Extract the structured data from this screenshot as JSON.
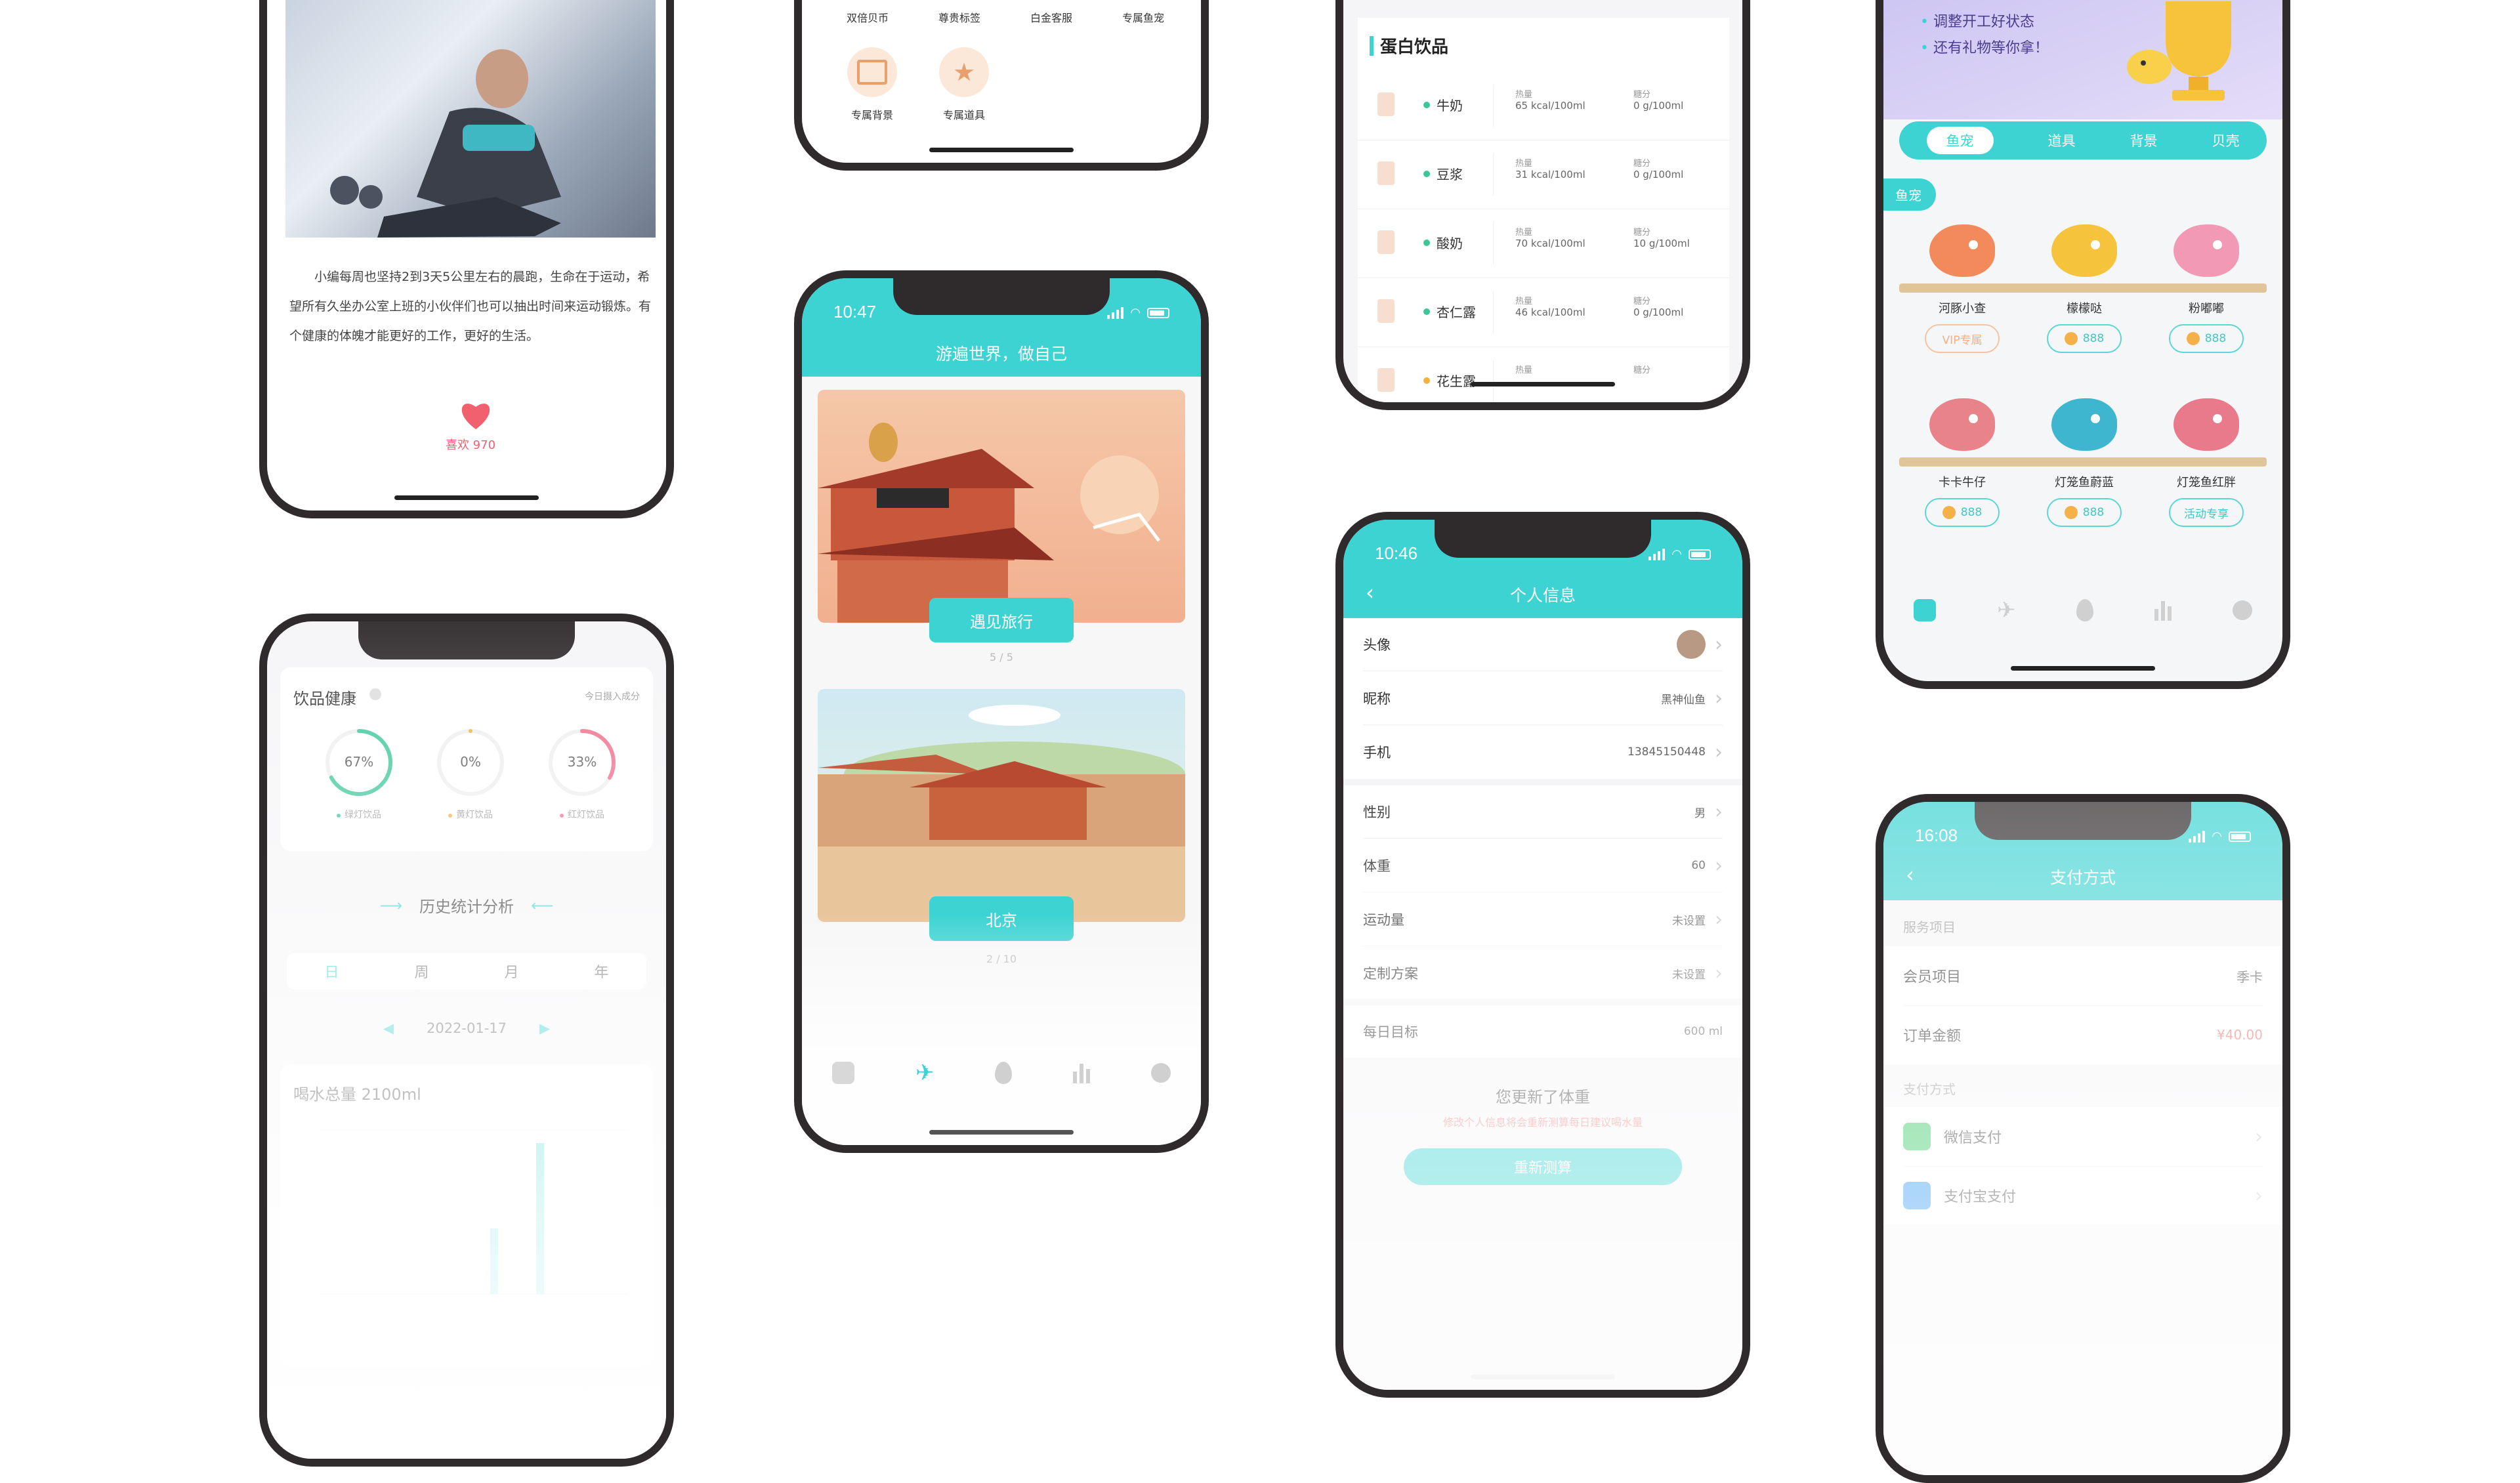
{
  "colors": {
    "accent": "#3dd3d2",
    "frame": "#2f2a2b",
    "heart": "#f0606f",
    "red_price": "#f06b6b"
  },
  "article_phone": {
    "body": "小编每周也坚持2到3天5公里左右的晨跑，生命在于运动，希望所有久坐办公室上班的小伙伴们也可以抽出时间来运动锻炼。有个健康的体魄才能更好的工作，更好的生活。",
    "like_label": "喜欢 970"
  },
  "vip_phone": {
    "benefits_top": [
      "双倍贝币",
      "尊贵标签",
      "白金客服",
      "专属鱼宠"
    ],
    "benefits_bottom": [
      "专属背景",
      "专属道具"
    ]
  },
  "protein_phone": {
    "section_title": "蛋白饮品",
    "items": [
      {
        "name": "牛奶",
        "heat_label": "热量",
        "heat": "65 kcal/100ml",
        "sugar_label": "糖分",
        "sugar": "0 g/100ml",
        "dot": "#3cc79a"
      },
      {
        "name": "豆浆",
        "heat_label": "热量",
        "heat": "31 kcal/100ml",
        "sugar_label": "糖分",
        "sugar": "0 g/100ml",
        "dot": "#3cc79a"
      },
      {
        "name": "酸奶",
        "heat_label": "热量",
        "heat": "70 kcal/100ml",
        "sugar_label": "糖分",
        "sugar": "10 g/100ml",
        "dot": "#3cc79a"
      },
      {
        "name": "杏仁露",
        "heat_label": "热量",
        "heat": "46 kcal/100ml",
        "sugar_label": "糖分",
        "sugar": "0 g/100ml",
        "dot": "#3cc79a"
      },
      {
        "name": "花生露",
        "heat_label": "热量",
        "heat": "",
        "sugar_label": "糖分",
        "sugar": "",
        "dot": "#f2b23c"
      }
    ]
  },
  "shop_phone": {
    "banner_lines": [
      "调整开工好状态",
      "还有礼物等你拿！"
    ],
    "tabs": [
      "鱼宠",
      "道具",
      "背景",
      "贝壳"
    ],
    "section_tag": "鱼宠",
    "row1": [
      {
        "name": "河豚小查",
        "price": "VIP专属"
      },
      {
        "name": "檬檬哒",
        "price": "888"
      },
      {
        "name": "粉嘟嘟",
        "price": "888"
      }
    ],
    "row2": [
      {
        "name": "卡卡牛仔",
        "price": "888"
      },
      {
        "name": "灯笼鱼蔚蓝",
        "price": "888"
      },
      {
        "name": "灯笼鱼红胖",
        "price": "活动专享"
      }
    ]
  },
  "drink_phone": {
    "card_title": "饮品健康",
    "card_right": "今日摄入成分",
    "rings": [
      {
        "pct": "67%",
        "label": "绿灯饮品",
        "color": "#3cc79a"
      },
      {
        "pct": "0%",
        "label": "黄灯饮品",
        "color": "#f2b23c"
      },
      {
        "pct": "33%",
        "label": "红灯饮品",
        "color": "#f06b8a"
      }
    ],
    "history_title": "历史统计分析",
    "periods": [
      "日",
      "周",
      "月",
      "年"
    ],
    "date": "2022-01-17",
    "total": "喝水总量 2100ml"
  },
  "travel_phone": {
    "time": "10:47",
    "title": "游遍世界，做自己",
    "card1_label": "遇见旅行",
    "card1_page": "5 / 5",
    "card2_label": "北京",
    "card2_page": "2 / 10"
  },
  "profile_phone": {
    "time": "10:46",
    "title": "个人信息",
    "rows": [
      {
        "label": "头像",
        "value": ""
      },
      {
        "label": "昵称",
        "value": "黑神仙鱼"
      },
      {
        "label": "手机",
        "value": "13845150448"
      },
      {
        "label": "性别",
        "value": "男"
      },
      {
        "label": "体重",
        "value": "60"
      },
      {
        "label": "运动量",
        "value": "未设置"
      },
      {
        "label": "定制方案",
        "value": "未设置"
      },
      {
        "label": "每日目标",
        "value": "600 ml"
      }
    ],
    "updated_title": "您更新了体重",
    "updated_sub": "修改个人信息将会重新测算每日建议喝水量",
    "remeasure_label": "重新测算"
  },
  "payment_phone": {
    "time": "16:08",
    "title": "支付方式",
    "service_section": "服务项目",
    "member_label": "会员项目",
    "member_value": "季卡",
    "amount_label": "订单金额",
    "amount_value": "¥40.00",
    "pay_section": "支付方式",
    "methods": [
      "微信支付",
      "支付宝支付"
    ]
  }
}
